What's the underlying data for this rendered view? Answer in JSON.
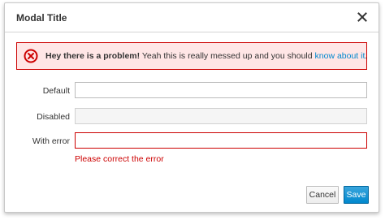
{
  "modal": {
    "title": "Modal Title",
    "close_icon": "close-icon"
  },
  "alert": {
    "icon": "error-circle-icon",
    "strong_text": "Hey there is a problem!",
    "body_text": " Yeah this is really messed up and you should ",
    "link_text": "know about it",
    "trailing": ".",
    "colors": {
      "border": "#cc0000",
      "background": "#ffe6e6",
      "link": "#0088ce"
    }
  },
  "form": {
    "default": {
      "label": "Default",
      "value": ""
    },
    "disabled": {
      "label": "Disabled",
      "value": ""
    },
    "error": {
      "label": "With error",
      "value": "",
      "message": "Please correct the error"
    }
  },
  "footer": {
    "cancel_label": "Cancel",
    "save_label": "Save"
  }
}
